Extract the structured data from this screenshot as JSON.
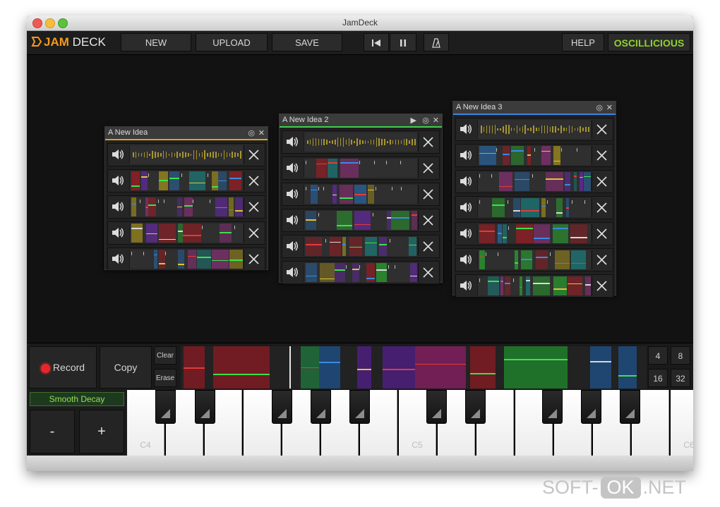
{
  "window": {
    "title": "JamDeck"
  },
  "logo": {
    "jam": "JAM",
    "deck": "DECK"
  },
  "toolbar": {
    "new_label": "NEW",
    "upload_label": "UPLOAD",
    "save_label": "SAVE",
    "help_label": "HELP",
    "brand_label": "OSCILLICIOUS"
  },
  "ideas": [
    {
      "name": "A New Idea",
      "accent": "#e0a020",
      "track_count": 5
    },
    {
      "name": "A New Idea 2",
      "accent": "#3ecf4a",
      "track_count": 6
    },
    {
      "name": "A New Idea 3",
      "accent": "#3f83e6",
      "track_count": 7
    }
  ],
  "sequencer": {
    "record_label": "Record",
    "copy_label": "Copy",
    "clear_label": "Clear",
    "erase_label": "Erase",
    "grid_options": [
      "4",
      "8",
      "16",
      "32"
    ]
  },
  "synth": {
    "preset": "Smooth Decay",
    "minus_label": "-",
    "plus_label": "+",
    "octave_labels": {
      "c4": "C4",
      "c5": "C5",
      "c6": "C6"
    }
  },
  "watermark": {
    "pre": "SOFT-",
    "ok": "OK",
    "post": ".NET"
  },
  "colors": {
    "record": "#e8262a",
    "brand": "#8fd22a",
    "logo": "#f59a1c"
  },
  "icons": [
    "speaker-icon",
    "close-icon",
    "solo-icon",
    "play-icon",
    "skip-back-icon",
    "pause-icon",
    "metronome-icon"
  ]
}
